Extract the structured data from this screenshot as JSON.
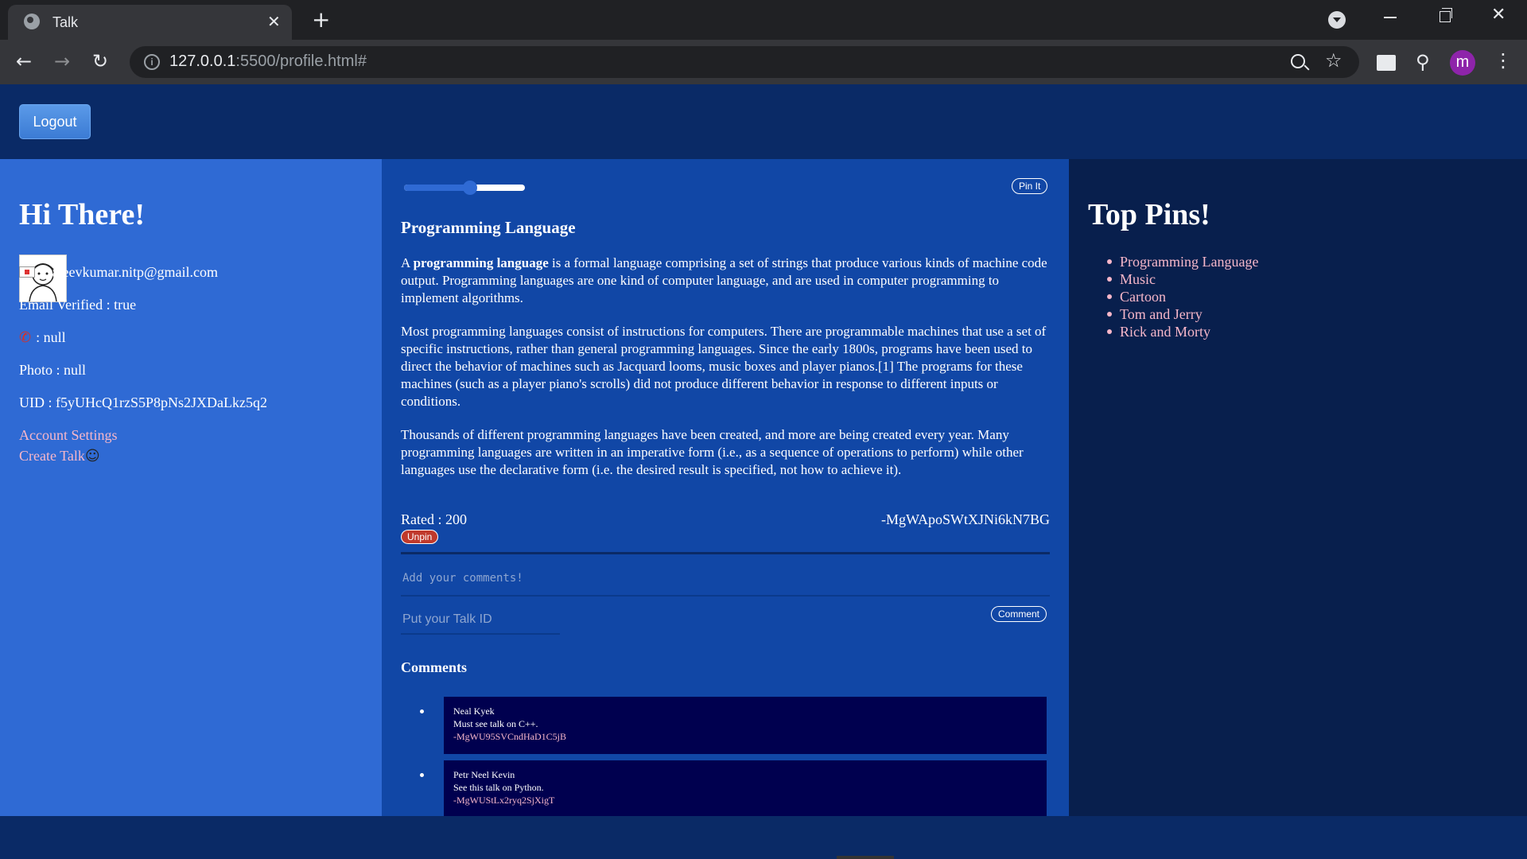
{
  "browser": {
    "tab_title": "Talk",
    "url_host": "127.0.0.1",
    "url_path": ":5500/profile.html#",
    "avatar_letter": "m"
  },
  "header": {
    "logout_label": "Logout"
  },
  "profile": {
    "greeting": "Hi There!",
    "email_line": ": rajeevkumar.nitp@gmail.com",
    "email_verified": "Email Verified : true",
    "phone_line": ": null",
    "photo_line": "Photo : null",
    "uid_line": "UID : f5yUHcQ1rzS5P8pNs2JXDaLkz5q2",
    "account_settings": "Account Settings",
    "create_talk": "Create Talk"
  },
  "talk": {
    "slider_value": 0.55,
    "pin_label": "Pin It",
    "title": "Programming Language",
    "para1_bold": "programming language",
    "para1_prefix": "A ",
    "para1_rest": " is a formal language comprising a set of strings that produce various kinds of machine code output. Programming languages are one kind of computer language, and are used in computer programming to implement algorithms.",
    "para2": "Most programming languages consist of instructions for computers. There are programmable machines that use a set of specific instructions, rather than general programming languages. Since the early 1800s, programs have been used to direct the behavior of machines such as Jacquard looms, music boxes and player pianos.[1] The programs for these machines (such as a player piano's scrolls) did not produce different behavior in response to different inputs or conditions.",
    "para3": "Thousands of different programming languages have been created, and more are being created every year. Many programming languages are written in an imperative form (i.e., as a sequence of operations to perform) while other languages use the declarative form (i.e. the desired result is specified, not how to achieve it).",
    "rated": "Rated : 200",
    "id": "-MgWApoSWtXJNi6kN7BG",
    "unpin_label": "Unpin",
    "comment_placeholder": "Add your comments!",
    "talkid_placeholder": "Put your Talk ID",
    "comment_button": "Comment",
    "comments_heading": "Comments",
    "comments": [
      {
        "author": "Neal Kyek",
        "text": "Must see talk on C++.",
        "id": "-MgWU95SVCndHaD1C5jB"
      },
      {
        "author": "Petr Neel Kevin",
        "text": "See this talk on Python.",
        "id": "-MgWUStLx2ryq2SjXigT"
      }
    ]
  },
  "pins": {
    "heading": "Top Pins!",
    "items": [
      "Programming Language",
      "Music",
      "Cartoon",
      "Tom and Jerry",
      "Rick and Morty"
    ]
  }
}
